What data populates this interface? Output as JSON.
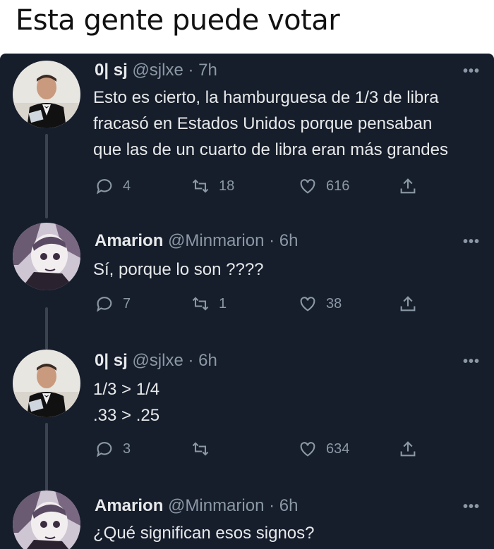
{
  "caption": "Esta gente puede votar",
  "tweets": [
    {
      "name": "0| sj",
      "handle": "@sjlxe",
      "time": "7h",
      "lines": [
        "Esto es cierto, la hamburguesa de 1/3 de libra",
        "fracasó en Estados Unidos porque pensaban",
        "que las de un cuarto de libra eran más grandes"
      ],
      "replies": "4",
      "retweets": "18",
      "likes": "616"
    },
    {
      "name": "Amarion",
      "handle": "@Minmarion",
      "time": "6h",
      "lines": [
        "Sí, porque lo son ????"
      ],
      "replies": "7",
      "retweets": "1",
      "likes": "38"
    },
    {
      "name": "0| sj",
      "handle": "@sjlxe",
      "time": "6h",
      "lines": [
        "1/3 > 1/4",
        ".33 > .25"
      ],
      "replies": "3",
      "retweets": "",
      "likes": "634"
    },
    {
      "name": "Amarion",
      "handle": "@Minmarion",
      "time": "6h",
      "lines": [
        "¿Qué significan esos signos?"
      ]
    }
  ],
  "icons": {
    "reply": "reply-icon",
    "retweet": "retweet-icon",
    "like": "heart-icon",
    "share": "share-icon",
    "more": "more-icon"
  },
  "colors": {
    "background": "#161d2b",
    "text": "#e7e9ea",
    "secondary": "#8b98a5"
  }
}
